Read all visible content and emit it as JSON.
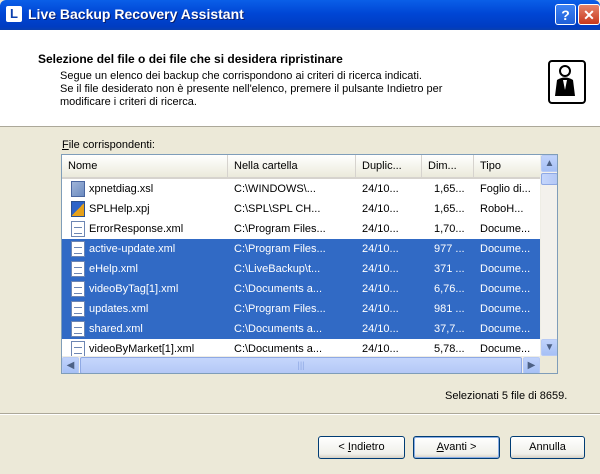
{
  "window": {
    "title": "Live Backup Recovery Assistant",
    "help_label": "?",
    "close_label": "✕",
    "app_icon_letter": "L"
  },
  "header": {
    "title": "Selezione del file o dei file che si desidera ripristinare",
    "desc_line1": "Segue un elenco dei backup che corrispondono ai criteri di ricerca indicati.",
    "desc_line2": "Se il file desiderato non è presente nell'elenco, premere il pulsante Indietro per",
    "desc_line3": "modificare i criteri di ricerca."
  },
  "files_label_underlined": "F",
  "files_label_rest": "ile corrispondenti:",
  "table": {
    "columns": [
      "Nome",
      "Nella cartella",
      "Duplic...",
      "Dim...",
      "Tipo"
    ],
    "rows": [
      {
        "icon": "xsl-file-icon",
        "name": "xpnetdiag.xsl",
        "folder": "C:\\WINDOWS\\...",
        "dup": "24/10...",
        "size": "1,65...",
        "type": "Foglio di...",
        "selected": false
      },
      {
        "icon": "xpj-file-icon",
        "name": "SPLHelp.xpj",
        "folder": "C:\\SPL\\SPL CH...",
        "dup": "24/10...",
        "size": "1,65...",
        "type": "RoboH...",
        "selected": false
      },
      {
        "icon": "xml-file-icon",
        "name": "ErrorResponse.xml",
        "folder": "C:\\Program Files...",
        "dup": "24/10...",
        "size": "1,70...",
        "type": "Docume...",
        "selected": false
      },
      {
        "icon": "xml-file-icon",
        "name": "active-update.xml",
        "folder": "C:\\Program Files...",
        "dup": "24/10...",
        "size": "977 ...",
        "type": "Docume...",
        "selected": true
      },
      {
        "icon": "xml-file-icon",
        "name": "eHelp.xml",
        "folder": "C:\\LiveBackup\\t...",
        "dup": "24/10...",
        "size": "371 ...",
        "type": "Docume...",
        "selected": true
      },
      {
        "icon": "xml-file-icon",
        "name": "videoByTag[1].xml",
        "folder": "C:\\Documents a...",
        "dup": "24/10...",
        "size": "6,76...",
        "type": "Docume...",
        "selected": true
      },
      {
        "icon": "xml-file-icon",
        "name": "updates.xml",
        "folder": "C:\\Program Files...",
        "dup": "24/10...",
        "size": "981 ...",
        "type": "Docume...",
        "selected": true
      },
      {
        "icon": "xml-file-icon",
        "name": "shared.xml",
        "folder": "C:\\Documents a...",
        "dup": "24/10...",
        "size": "37,7...",
        "type": "Docume...",
        "selected": true
      },
      {
        "icon": "xml-file-icon",
        "name": "videoByMarket[1].xml",
        "folder": "C:\\Documents a...",
        "dup": "24/10...",
        "size": "5,78...",
        "type": "Docume...",
        "selected": false
      }
    ]
  },
  "status": "Selezionati 5 file di 8659.",
  "buttons": {
    "back_prefix": "< ",
    "back_ul": "I",
    "back_rest": "ndietro",
    "next_ul": "A",
    "next_rest": "vanti >",
    "cancel": "Annulla"
  },
  "colors": {
    "selection": "#316AC5",
    "titlebar": "#0046D5",
    "dialog_bg": "#ECE9D8"
  }
}
